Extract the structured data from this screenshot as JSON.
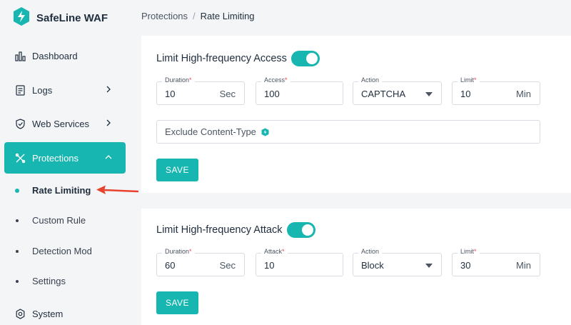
{
  "app": {
    "title": "SafeLine WAF"
  },
  "sidebar": {
    "items": [
      {
        "label": "Dashboard",
        "icon": "bar-chart-icon"
      },
      {
        "label": "Logs",
        "icon": "document-icon"
      },
      {
        "label": "Web Services",
        "icon": "shield-icon"
      },
      {
        "label": "Protections",
        "icon": "tools-icon"
      },
      {
        "label": "System",
        "icon": "gear-icon"
      }
    ],
    "subitems": [
      {
        "label": "Rate Limiting"
      },
      {
        "label": "Custom Rule"
      },
      {
        "label": "Detection Mod"
      },
      {
        "label": "Settings"
      }
    ]
  },
  "breadcrumb": {
    "parent": "Protections",
    "separator": "/",
    "current": "Rate Limiting"
  },
  "panels": [
    {
      "title": "Limit High-frequency Access",
      "toggle_on": true,
      "fields": [
        {
          "label": "Duration",
          "required": "*",
          "value": "10",
          "unit": "Sec"
        },
        {
          "label": "Access",
          "required": "*",
          "value": "100"
        },
        {
          "label": "Action",
          "value": "CAPTCHA"
        },
        {
          "label": "Limit",
          "required": "*",
          "value": "10",
          "unit": "Min"
        }
      ],
      "exclude_label": "Exclude Content-Type",
      "save_label": "SAVE"
    },
    {
      "title": "Limit High-frequency Attack",
      "toggle_on": true,
      "fields": [
        {
          "label": "Duration",
          "required": "*",
          "value": "60",
          "unit": "Sec"
        },
        {
          "label": "Attack",
          "required": "*",
          "value": "10"
        },
        {
          "label": "Action",
          "value": "Block"
        },
        {
          "label": "Limit",
          "required": "*",
          "value": "30",
          "unit": "Min"
        }
      ],
      "save_label": "SAVE"
    }
  ],
  "colors": {
    "accent": "#17b6b0",
    "annotation_arrow": "#e8432e",
    "required": "#e5484d"
  }
}
